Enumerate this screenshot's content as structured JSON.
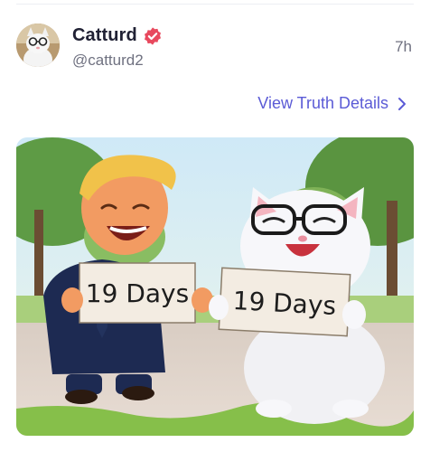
{
  "post": {
    "author": {
      "name": "Catturd",
      "handle": "@catturd2",
      "verified": true,
      "avatar_icon": "cat-with-glasses-avatar"
    },
    "timestamp": "7h",
    "view_details_label": "View Truth Details",
    "media": {
      "signs": [
        "19 Days",
        "19 Days"
      ]
    }
  },
  "colors": {
    "verified": "#e8495e",
    "link": "#5b5bd6",
    "muted_text": "#6f7180"
  }
}
